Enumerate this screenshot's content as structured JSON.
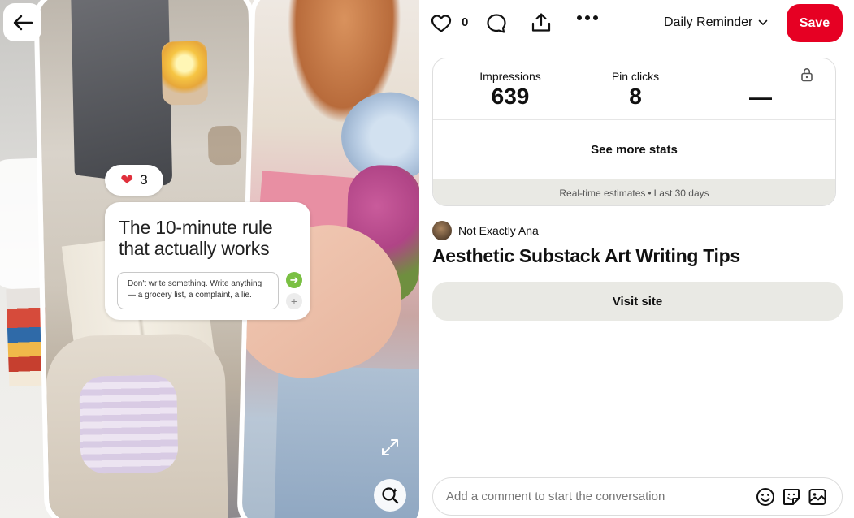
{
  "image": {
    "overlay_card": {
      "heart_count": "3",
      "title": "The 10-minute rule that actually works",
      "body": "Don't write something. Write anything — a grocery list, a complaint, a lie."
    }
  },
  "toolbar": {
    "like_count": "0",
    "board_name": "Daily Reminder",
    "save_label": "Save"
  },
  "stats": {
    "impressions_label": "Impressions",
    "impressions_value": "639",
    "pin_clicks_label": "Pin clicks",
    "pin_clicks_value": "8",
    "third_value": "—",
    "see_more_label": "See more stats",
    "footer_left": "Real-time estimates",
    "footer_sep": "•",
    "footer_right": "Last 30 days"
  },
  "pin": {
    "author_name": "Not Exactly Ana",
    "title": "Aesthetic Substack Art Writing Tips",
    "visit_label": "Visit site"
  },
  "comment": {
    "placeholder": "Add a comment to start the conversation"
  },
  "colors": {
    "brand_red": "#e60023",
    "secondary_button": "#e9e9e4",
    "accent_green": "#7ac043"
  },
  "icons": [
    "back-arrow-icon",
    "heart-icon",
    "comment-icon",
    "share-icon",
    "more-icon",
    "chevron-down-icon",
    "lock-icon",
    "expand-icon",
    "visual-search-icon",
    "emoji-icon",
    "sticker-icon",
    "gif-icon"
  ]
}
